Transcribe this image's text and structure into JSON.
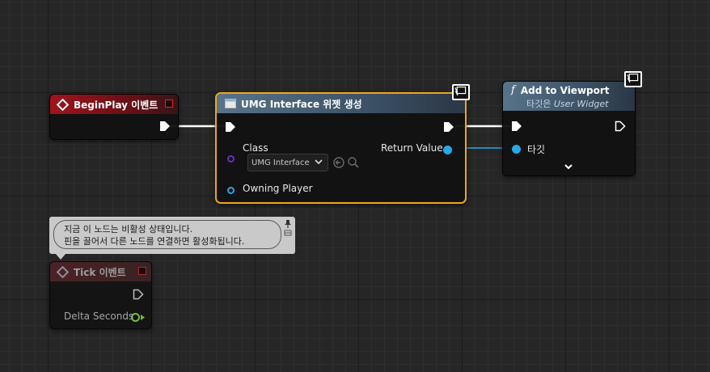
{
  "nodes": {
    "begin_play": {
      "title": "BeginPlay 이벤트"
    },
    "create_widget": {
      "title": "UMG Interface 위젯 생성",
      "class_label": "Class",
      "class_value": "UMG Interface",
      "return_label": "Return Value",
      "owning_player_label": "Owning Player"
    },
    "add_to_viewport": {
      "title": "Add to Viewport",
      "subtitle_prefix": "타깃은 ",
      "subtitle_target": "User Widget",
      "target_label": "타깃"
    },
    "tick": {
      "title": "Tick 이벤트",
      "delta_label": "Delta Seconds"
    }
  },
  "tooltip": {
    "line1": "지금 이 노드는 비활성 상태입니다.",
    "line2": "핀을 끌어서 다른 노드를 연결하면 활성화됩니다."
  },
  "colors": {
    "event_header": "#a0141c",
    "function_header": "#58738a",
    "selection": "#f2a51a",
    "object_pin": "#27a8e8",
    "class_pin": "#6b2fbf",
    "float_pin": "#7bc943"
  }
}
